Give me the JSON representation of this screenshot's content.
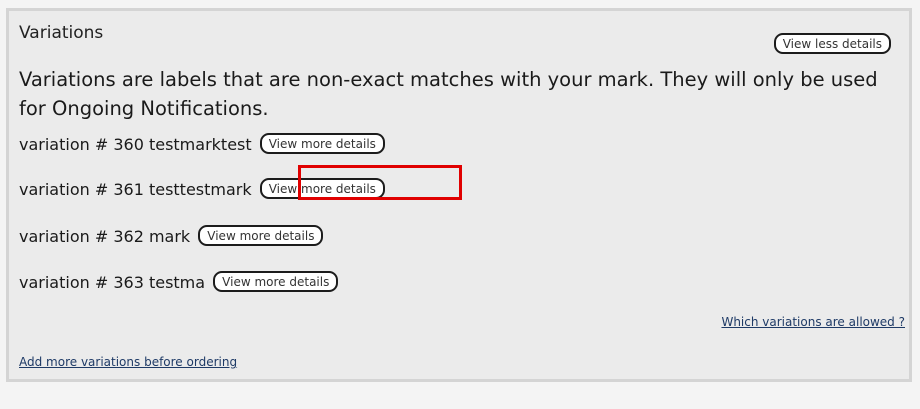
{
  "panel": {
    "title": "Variations",
    "view_less_label": "View less details",
    "description": "Variations are labels that are non-exact matches with your mark. They will only be used for Ongoing Notifications.",
    "variations": [
      {
        "label": "variation # 360 testmarktest",
        "button_label": "View more details"
      },
      {
        "label": "variation # 361 testtestmark",
        "button_label": "View more details"
      },
      {
        "label": "variation # 362 mark",
        "button_label": "View more details"
      },
      {
        "label": "variation # 363 testma",
        "button_label": "View more details"
      }
    ],
    "which_allowed_link": "Which variations are allowed ?",
    "add_more_link": "Add more variations before ordering"
  },
  "colors": {
    "highlight": "#e00000",
    "link": "#1e3a66",
    "panel_bg": "#ebebeb"
  }
}
